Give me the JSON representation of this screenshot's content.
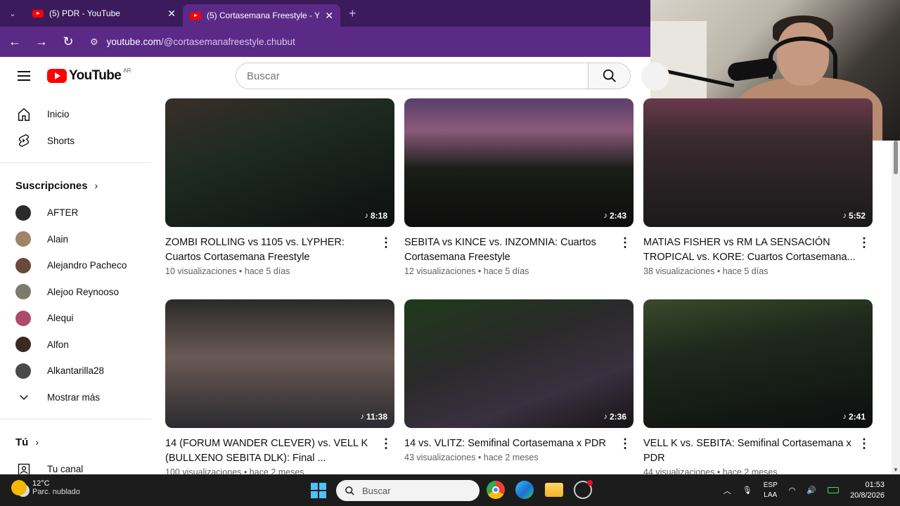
{
  "browser": {
    "tabs": [
      {
        "title": "(5) PDR - YouTube",
        "active": false
      },
      {
        "title": "(5) Cortasemana Freestyle - You",
        "active": true
      }
    ],
    "url_host": "youtube.com",
    "url_path": "/@cortasemanafreestyle.chubut"
  },
  "header": {
    "logo_text": "YouTube",
    "country_code": "AR",
    "search_placeholder": "Buscar"
  },
  "sidebar": {
    "main": [
      {
        "label": "Inicio",
        "icon": "home-icon"
      },
      {
        "label": "Shorts",
        "icon": "shorts-icon"
      }
    ],
    "subscriptions_title": "Suscripciones",
    "subscriptions": [
      {
        "label": "AFTER",
        "color": "#2b2b2b"
      },
      {
        "label": "Alain",
        "color": "#a08468"
      },
      {
        "label": "Alejandro Pacheco",
        "color": "#6a4a3a"
      },
      {
        "label": "Alejoo Reynooso",
        "color": "#7b7b6a"
      },
      {
        "label": "Alequi",
        "color": "#b04a6a"
      },
      {
        "label": "Alfon",
        "color": "#3a2a24"
      },
      {
        "label": "Alkantarilla28",
        "color": "#4a4a4a"
      }
    ],
    "show_more": "Mostrar más",
    "you_title": "Tú",
    "your_channel": "Tu canal"
  },
  "videos": [
    {
      "title": "ZOMBI ROLLING vs 1105 vs. LYPHER: Cuartos Cortasemana Freestyle",
      "views": "10 visualizaciones",
      "age": "hace 5 días",
      "duration": "8:18",
      "bg": "linear-gradient(160deg,#3a2e2a 0%,#1d2a22 40%,#0e0f10 100%)"
    },
    {
      "title": "SEBITA vs KINCE vs. INZOMNIA: Cuartos Cortasemana Freestyle",
      "views": "12 visualizaciones",
      "age": "hace 5 días",
      "duration": "2:43",
      "bg": "linear-gradient(180deg,#5a3f6a 0%,#8a5a7a 25%,#1a1d18 55%,#0d0d0d 100%)"
    },
    {
      "title": "MATIAS FISHER vs RM LA SENSACIÓN TROPICAL vs. KORE: Cuartos Cortasemana...",
      "views": "38 visualizaciones",
      "age": "hace 5 días",
      "duration": "5:52",
      "bg": "linear-gradient(180deg,#6a3a4a 0%,#3a2a30 30%,#1a1a1a 100%)"
    },
    {
      "title": "14 (FORUM WANDER CLEVER) vs. VELL K (BULLXENO SEBITA DLK): Final ...",
      "views": "100 visualizaciones",
      "age": "hace 2 meses",
      "duration": "11:38",
      "bg": "linear-gradient(180deg,#2a2a2a 0%,#6a5a55 45%,#2b2b30 100%)"
    },
    {
      "title": "14 vs. VLITZ: Semifinal Cortasemana x PDR",
      "views": "43 visualizaciones",
      "age": "hace 2 meses",
      "duration": "2:36",
      "bg": "linear-gradient(160deg,#1f3a1a 0%,#2a2a2a 40%,#3a3040 70%,#151515 100%)"
    },
    {
      "title": "VELL K vs. SEBITA: Semifinal Cortasemana x PDR",
      "views": "44 visualizaciones",
      "age": "hace 2 meses",
      "duration": "2:41",
      "bg": "linear-gradient(170deg,#3a4a2a 0%,#1e2a1c 35%,#0e0e10 100%)"
    }
  ],
  "taskbar": {
    "temperature": "12°C",
    "weather": "Parc. nublado",
    "search_placeholder": "Buscar",
    "lang_top": "ESP",
    "lang_bottom": "LAA",
    "time": "01:53",
    "date": "20/8/2026"
  }
}
